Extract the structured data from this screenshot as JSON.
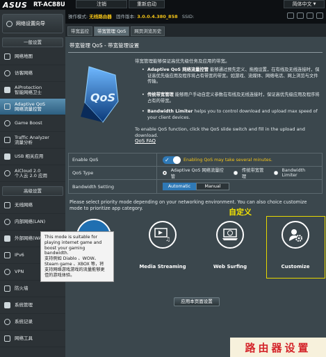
{
  "header": {
    "brand": "ASUS",
    "model": "RT-AC88U",
    "logout_label": "注销",
    "reboot_label": "重新启动",
    "language_label": "简体中文"
  },
  "infobar": {
    "mode_label": "操作模式:",
    "mode_value": "无线路由器",
    "firmware_label": "固件版本:",
    "firmware_value": "3.0.0.4.380_858",
    "ssid_label": "SSID:"
  },
  "sidebar": {
    "quick_setup": "网络设置向导",
    "general_header": "一般设置",
    "general_items": [
      {
        "label": "网络地图",
        "icon": "network-map-icon"
      },
      {
        "label": "访客网络",
        "icon": "guest-network-icon"
      },
      {
        "label": "AiProtection\n智能网络卫士",
        "icon": "shield-icon"
      },
      {
        "label": "Adaptive QoS\n网络流量控管",
        "icon": "qos-icon",
        "active": true
      },
      {
        "label": "Game Boost",
        "icon": "game-boost-icon"
      },
      {
        "label": "Traffic Analyzer\n流量分析",
        "icon": "traffic-analyzer-icon"
      },
      {
        "label": "USB 相关应用",
        "icon": "usb-icon"
      },
      {
        "label": "AiCloud 2.0\n个人云 2.0 应用",
        "icon": "cloud-icon"
      }
    ],
    "advanced_header": "高级设置",
    "advanced_items": [
      {
        "label": "无线网络",
        "icon": "wireless-icon"
      },
      {
        "label": "内部网络(LAN)",
        "icon": "lan-icon"
      },
      {
        "label": "外部网络(WAN)",
        "icon": "wan-icon"
      },
      {
        "label": "IPv6",
        "icon": "ipv6-icon"
      },
      {
        "label": "VPN",
        "icon": "vpn-icon"
      },
      {
        "label": "防火墙",
        "icon": "firewall-icon"
      },
      {
        "label": "系统管理",
        "icon": "admin-icon"
      },
      {
        "label": "系统记录",
        "icon": "syslog-icon"
      },
      {
        "label": "网络工具",
        "icon": "network-tools-icon"
      }
    ]
  },
  "tabs": [
    "带宽监控",
    "带宽管理 QoS",
    "网页浏览历史"
  ],
  "panel": {
    "title": "带宽管理 QoS - 带宽管理设置",
    "intro": "带宽管理能够保证高优先级任务及应用的带宽。",
    "bullets": [
      {
        "name": "Adaptive QoS 网络流量控管",
        "text": "能够通过预先定义、拖拽设置，在有线及无线连接时，保证高优先级应用及程序将占有带宽的带宽。如游戏、流媒体、网络电话、网上浏览与文件传输。"
      },
      {
        "name": "传统带宽管理",
        "text": "能够用户手动自定义参数在有线及无线连接时，保证高优先级应用及程序将占有的带宽。"
      },
      {
        "name": "Bandwidth Limiter",
        "text": "helps you to control download and upload max speed of your client devices."
      }
    ],
    "enable_note": "To enable QoS function, click the QoS slide switch and fill in the upload and download.",
    "faq": "QoS FAQ",
    "logo_text": "QoS"
  },
  "settings": {
    "enable_qos_label": "Enable QoS",
    "enable_qos_on": true,
    "enable_qos_warning": "Enabling QoS may take several minutes.",
    "qos_type_label": "QoS Type",
    "qos_type_options": [
      "Adaptive QoS 网络流量控管",
      "传统带宽管理",
      "Bandwidth Limiter"
    ],
    "qos_type_selected": "Adaptive QoS 网络流量控管",
    "bandwidth_label": "Bandwidth Setting",
    "bandwidth_options": [
      "Automatic",
      "Manual"
    ],
    "bandwidth_selected": "Automatic"
  },
  "modes": {
    "prompt": "Please select priority mode depending on your networking environment. You can also choice customize mode to prioritize app category.",
    "annotation": "自定义",
    "items": [
      {
        "label": "Media Streaming",
        "icon": "media-streaming-icon"
      },
      {
        "label": "Web Surfing",
        "icon": "web-surfing-icon"
      },
      {
        "label": "Customize",
        "icon": "customize-icon"
      }
    ],
    "gaming_tooltip": "This mode is suitable for\nplaying internet game and\nboost your gaming\nbandwidth.\n支持例如 Diablo 、WOW、\nSteam game 、XBOX 等，将\n支持网络游戏游戏的流量能够更\n佳的游戏体验。",
    "apply_label": "应用本页面设置"
  },
  "watermark": "路由器设置",
  "colors": {
    "accent": "#2f79b6",
    "warning": "#f5c518",
    "highlight_box": "#e8d900",
    "watermark": "#d4242a"
  }
}
